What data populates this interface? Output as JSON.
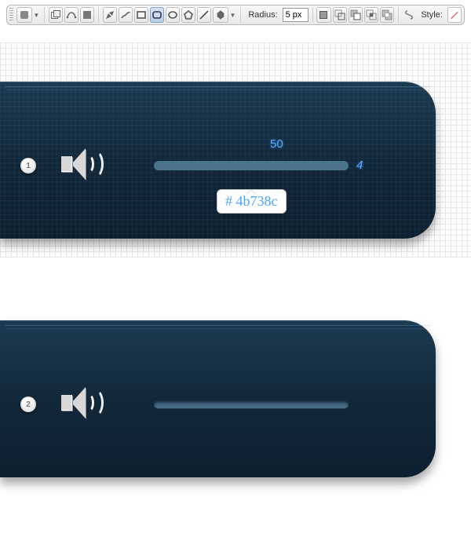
{
  "toolbar": {
    "radius_label": "Radius:",
    "radius_value": "5 px",
    "style_label": "Style:"
  },
  "step1": {
    "badge": "1",
    "width_label": "50",
    "height_label": "4",
    "hex": "# 4b738c",
    "slider_color": "#4b738c"
  },
  "step2": {
    "badge": "2"
  }
}
